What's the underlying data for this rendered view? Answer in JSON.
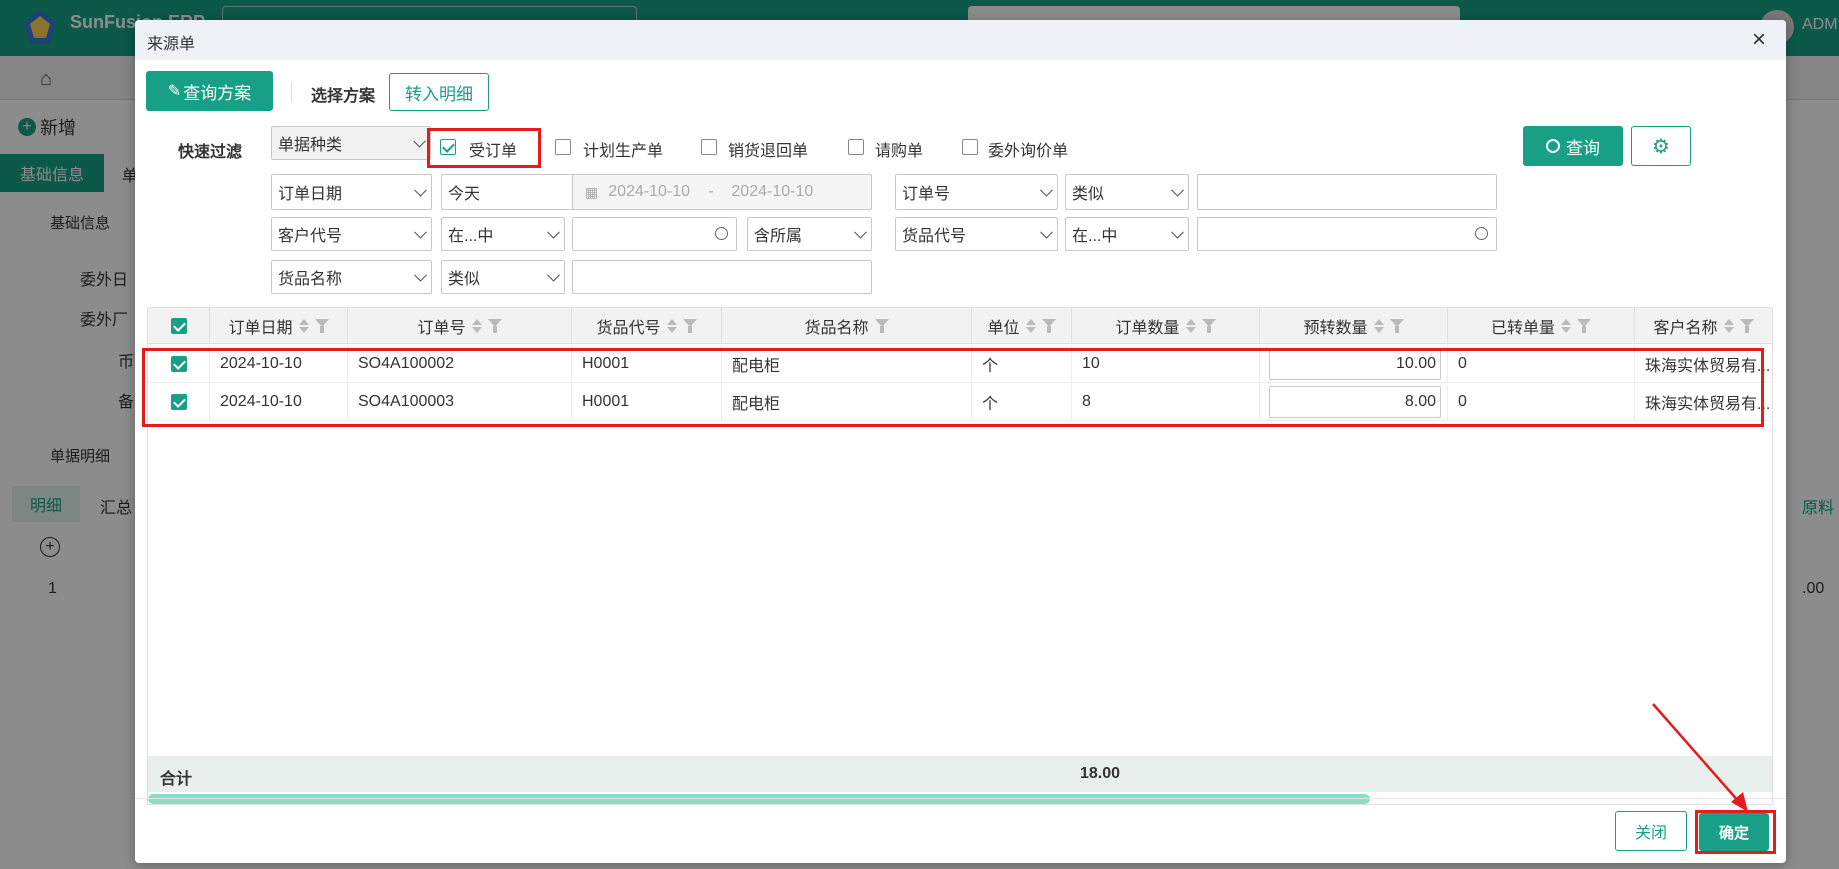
{
  "app": {
    "logo_text": "SunFusion ERP",
    "user": "ADM",
    "new_button": "新增",
    "tabs": [
      "基础信息",
      "单"
    ],
    "section_basic": "基础信息",
    "field_labels": [
      "委外日",
      "委外厂",
      "币",
      "备"
    ],
    "section_detail": "单据明细",
    "detail_tabs": [
      "明细",
      "汇总"
    ],
    "row_index": "1",
    "right_tab": "原料",
    "right_value": ".00"
  },
  "dialog": {
    "title": "来源单",
    "close_glyph": "×",
    "toolbar": {
      "query_scheme": "查询方案",
      "select_scheme_label": "选择方案",
      "to_detail": "转入明细"
    },
    "filter": {
      "quick_filter_label": "快速过滤",
      "doc_type_select": "单据种类",
      "types": [
        {
          "label": "受订单",
          "checked": true
        },
        {
          "label": "计划生产单",
          "checked": false
        },
        {
          "label": "销货退回单",
          "checked": false
        },
        {
          "label": "请购单",
          "checked": false
        },
        {
          "label": "委外询价单",
          "checked": false
        }
      ],
      "query_button": "查询",
      "row1": {
        "field": "订单日期",
        "op": "今天",
        "date_from": "2024-10-10",
        "date_sep": "-",
        "date_to": "2024-10-10",
        "field2": "订单号",
        "op2": "类似",
        "value2": ""
      },
      "row2": {
        "field": "客户代号",
        "op": "在...中",
        "value": "",
        "extra": "含所属",
        "field2": "货品代号",
        "op2": "在...中",
        "value2": ""
      },
      "row3": {
        "field": "货品名称",
        "op": "类似",
        "value": ""
      }
    },
    "grid": {
      "columns": [
        "订单日期",
        "订单号",
        "货品代号",
        "货品名称",
        "单位",
        "订单数量",
        "预转数量",
        "已转单量",
        "客户名称"
      ],
      "rows": [
        {
          "checked": true,
          "date": "2024-10-10",
          "order_no": "SO4A100002",
          "item_code": "H0001",
          "item_name": "配电柜",
          "unit": "个",
          "qty": "10",
          "pre_qty": "10.00",
          "done_qty": "0",
          "customer": "珠海实体贸易有..."
        },
        {
          "checked": true,
          "date": "2024-10-10",
          "order_no": "SO4A100003",
          "item_code": "H0001",
          "item_name": "配电柜",
          "unit": "个",
          "qty": "8",
          "pre_qty": "8.00",
          "done_qty": "0",
          "customer": "珠海实体贸易有..."
        }
      ],
      "total_label": "合计",
      "total_qty": "18.00"
    },
    "footer": {
      "close_button": "关闭",
      "ok_button": "确定"
    }
  },
  "colors": {
    "accent": "#17a086",
    "highlight": "#e51c1c"
  }
}
